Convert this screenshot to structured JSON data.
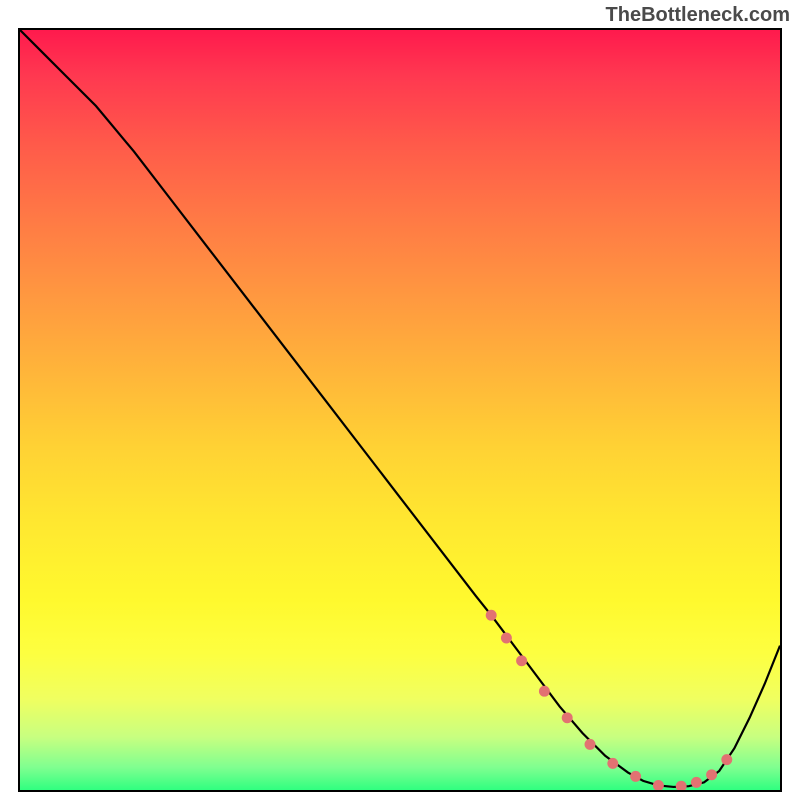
{
  "watermark": "TheBottleneck.com",
  "chart_data": {
    "type": "line",
    "title": "",
    "xlabel": "",
    "ylabel": "",
    "xlim": [
      0,
      100
    ],
    "ylim": [
      0,
      100
    ],
    "grid": false,
    "legend": false,
    "background": "gradient-heat",
    "series": [
      {
        "name": "curve",
        "color": "#000000",
        "x": [
          0,
          3,
          6,
          10,
          15,
          20,
          25,
          30,
          35,
          40,
          45,
          50,
          55,
          60,
          62,
          65,
          68,
          71,
          74,
          77,
          80,
          82,
          84,
          86,
          88,
          90,
          92,
          94,
          96,
          98,
          100
        ],
        "y": [
          100,
          97,
          94,
          90,
          84,
          77.5,
          71,
          64.5,
          58,
          51.5,
          45,
          38.5,
          32,
          25.5,
          23,
          19,
          15,
          11,
          7.5,
          4.5,
          2.3,
          1.2,
          0.6,
          0.4,
          0.5,
          1.0,
          2.5,
          5.5,
          9.5,
          14,
          19
        ]
      }
    ],
    "marker_points": {
      "name": "optimal-zone-dots",
      "color": "#e27272",
      "x": [
        62,
        64,
        66,
        69,
        72,
        75,
        78,
        81,
        84,
        87,
        89,
        91,
        93
      ],
      "y": [
        23,
        20,
        17,
        13,
        9.5,
        6,
        3.5,
        1.8,
        0.6,
        0.5,
        1.0,
        2.0,
        4.0
      ]
    }
  }
}
